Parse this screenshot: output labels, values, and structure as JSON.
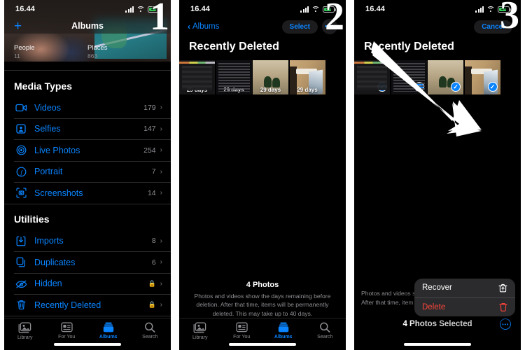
{
  "meta": {
    "accent_blue": "#0a84ff",
    "danger_red": "#ff453a",
    "bg_black": "#000000",
    "secondary_gray": "#8e8e93"
  },
  "panels": [
    {
      "step_number": "1",
      "status_bar": {
        "time": "16.44",
        "battery_level": "24",
        "cellular": "signal-bars-icon",
        "wifi": "wifi-icon"
      },
      "nav": {
        "add_label": "+",
        "title": "Albums"
      },
      "covers": [
        {
          "title": "People",
          "count": "11"
        },
        {
          "title": "Places",
          "count": "863"
        }
      ],
      "sections": [
        {
          "header": "Media Types",
          "rows": [
            {
              "icon": "video-camera-icon",
              "label": "Videos",
              "count": "179",
              "locked": false
            },
            {
              "icon": "selfie-portrait-icon",
              "label": "Selfies",
              "count": "147",
              "locked": false
            },
            {
              "icon": "live-photo-icon",
              "label": "Live Photos",
              "count": "254",
              "locked": false
            },
            {
              "icon": "portrait-f-icon",
              "label": "Portrait",
              "count": "7",
              "locked": false
            },
            {
              "icon": "screenshot-icon",
              "label": "Screenshots",
              "count": "14",
              "locked": false
            }
          ]
        },
        {
          "header": "Utilities",
          "rows": [
            {
              "icon": "import-tray-icon",
              "label": "Imports",
              "count": "8",
              "locked": false
            },
            {
              "icon": "duplicate-squares-icon",
              "label": "Duplicates",
              "count": "6",
              "locked": false
            },
            {
              "icon": "eye-slash-icon",
              "label": "Hidden",
              "count": "",
              "locked": true
            },
            {
              "icon": "trash-icon",
              "label": "Recently Deleted",
              "count": "",
              "locked": true
            }
          ]
        }
      ],
      "tabs": [
        {
          "icon": "photo-stack-icon",
          "label": "Library",
          "active": false
        },
        {
          "icon": "for-you-card-icon",
          "label": "For You",
          "active": false
        },
        {
          "icon": "albums-book-icon",
          "label": "Albums",
          "active": true
        },
        {
          "icon": "search-icon",
          "label": "Search",
          "active": false
        }
      ]
    },
    {
      "step_number": "2",
      "status_bar": {
        "time": "16.44",
        "battery_level": "24",
        "cellular": "signal-bars-icon",
        "wifi": "wifi-icon"
      },
      "nav": {
        "back_label": "Albums",
        "select_label": "Select",
        "more_label": "•••"
      },
      "title": "Recently Deleted",
      "thumbnails": [
        {
          "art": "t-dark",
          "days_label": "29 days",
          "selected": false
        },
        {
          "art": "t-text",
          "days_label": "29 days",
          "selected": false
        },
        {
          "art": "t-outdoor2",
          "days_label": "29 days",
          "selected": false
        },
        {
          "art": "t-room",
          "days_label": "29 days",
          "selected": false
        }
      ],
      "footer": {
        "count_label": "4 Photos",
        "description": "Photos and videos show the days remaining before deletion. After that time, items will be permanently deleted. This may take up to 40 days."
      },
      "tabs": [
        {
          "icon": "photo-stack-icon",
          "label": "Library",
          "active": false
        },
        {
          "icon": "for-you-card-icon",
          "label": "For You",
          "active": false
        },
        {
          "icon": "albums-book-icon",
          "label": "Albums",
          "active": true
        },
        {
          "icon": "search-icon",
          "label": "Search",
          "active": false
        }
      ]
    },
    {
      "step_number": "3",
      "status_bar": {
        "time": "16.44",
        "battery_level": "24",
        "cellular": "signal-bars-icon",
        "wifi": "wifi-icon"
      },
      "nav": {
        "cancel_label": "Cancel"
      },
      "title": "Recently Deleted",
      "thumbnails": [
        {
          "art": "t-dark",
          "days_label": "",
          "selected": true,
          "check": "✓"
        },
        {
          "art": "t-text",
          "days_label": "",
          "selected": true,
          "check": "✓"
        },
        {
          "art": "t-outdoor2",
          "days_label": "",
          "selected": true,
          "check": "✓"
        },
        {
          "art": "t-room",
          "days_label": "",
          "selected": true,
          "check": "✓"
        }
      ],
      "footer": {
        "description_line1": "Photos and videos s",
        "description_line2": "After that time, item"
      },
      "context_menu": [
        {
          "label": "Recover",
          "icon": "recover-tray-icon",
          "danger": false
        },
        {
          "label": "Delete",
          "icon": "trash-icon",
          "danger": true
        }
      ],
      "selection_bar": {
        "label": "4 Photos Selected",
        "more_label": "•••"
      },
      "annotation": {
        "arrow": "pointer-arrow"
      }
    }
  ]
}
